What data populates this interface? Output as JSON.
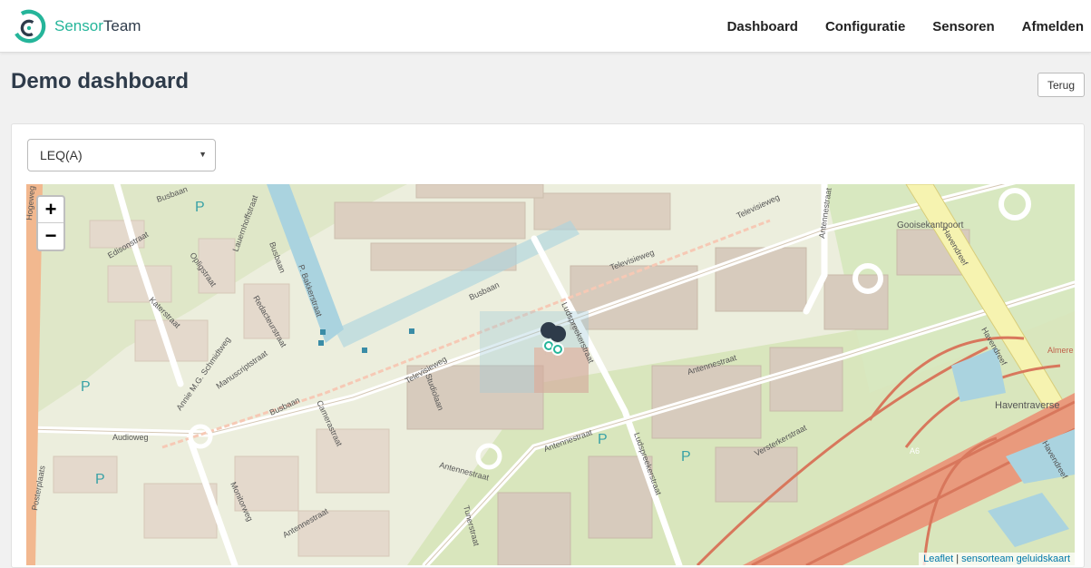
{
  "header": {
    "brand_part1": "Sensor",
    "brand_part2": "Team",
    "nav": [
      "Dashboard",
      "Configuratie",
      "Sensoren",
      "Afmelden"
    ]
  },
  "page": {
    "title": "Demo dashboard",
    "back_label": "Terug"
  },
  "metric_select": {
    "selected": "LEQ(A)"
  },
  "map": {
    "zoom_in": "+",
    "zoom_out": "−",
    "attribution_leaflet": "Leaflet",
    "attribution_separator": "|",
    "attribution_source": "sensorteam geluidskaart",
    "street_labels": [
      "Busbaan",
      "Edisonstraat",
      "Opligstraat",
      "Katerstraat",
      "Annie M.G. Schmidtweg",
      "Manuscriptstraat",
      "Redacteurstraat",
      "Busbaan",
      "P. Bakkerstraat",
      "Lauernhoffstraat",
      "Busbaan",
      "Televisieweg",
      "Televisieweg",
      "Ludspreekerstraat",
      "Televisieweg",
      "Antennestraat",
      "Antennestraat",
      "Audioweg",
      "Camerastraat",
      "Studiolaan",
      "Busbaan",
      "Antennestraat",
      "Antennestraat",
      "Ludspreekerstraat",
      "Versterkerstraat",
      "Monitorweg",
      "Antennestraat",
      "Tunerstraat",
      "Havendreef",
      "Havendreef",
      "Havendreef",
      "Gooisekantpoort",
      "Haventraverse",
      "A6",
      "Almere",
      "Posterplaats",
      "Hogeweg"
    ],
    "parking_label": "P",
    "marker_icon": "sensor-pin-icon"
  },
  "colors": {
    "accent": "#25b59a",
    "brand_dark": "#2e3b4a",
    "map_link": "#0078a8"
  }
}
